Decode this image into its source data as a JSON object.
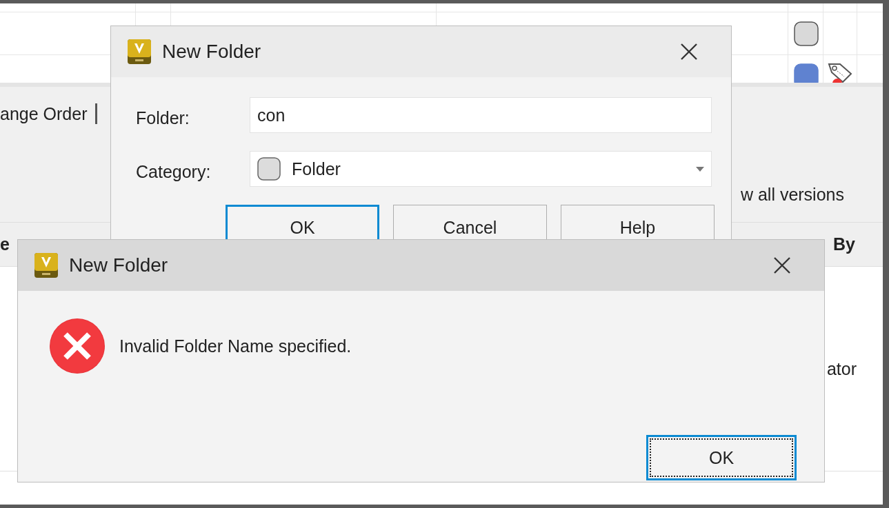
{
  "background": {
    "toolbar_text": "ange Order",
    "versions_link": "w all versions",
    "header_cells": [
      "e",
      "By"
    ],
    "cell_text": "ator",
    "status_swatches": [
      {
        "color": "#d9d9d9"
      },
      {
        "color": "#5f82d0"
      }
    ]
  },
  "new_folder_dialog": {
    "title": "New Folder",
    "fields": [
      {
        "kind": "text",
        "label": "Folder:",
        "value": "con"
      },
      {
        "kind": "select",
        "label": "Category:",
        "value": "Folder"
      }
    ],
    "buttons": [
      {
        "label": "OK",
        "default": true,
        "focused": false
      },
      {
        "label": "Cancel",
        "default": false,
        "focused": false
      },
      {
        "label": "Help",
        "default": false,
        "focused": false
      }
    ]
  },
  "error_dialog": {
    "title": "New Folder",
    "message": "Invalid Folder Name specified.",
    "buttons": [
      {
        "label": "OK",
        "default": true,
        "focused": true
      }
    ]
  }
}
